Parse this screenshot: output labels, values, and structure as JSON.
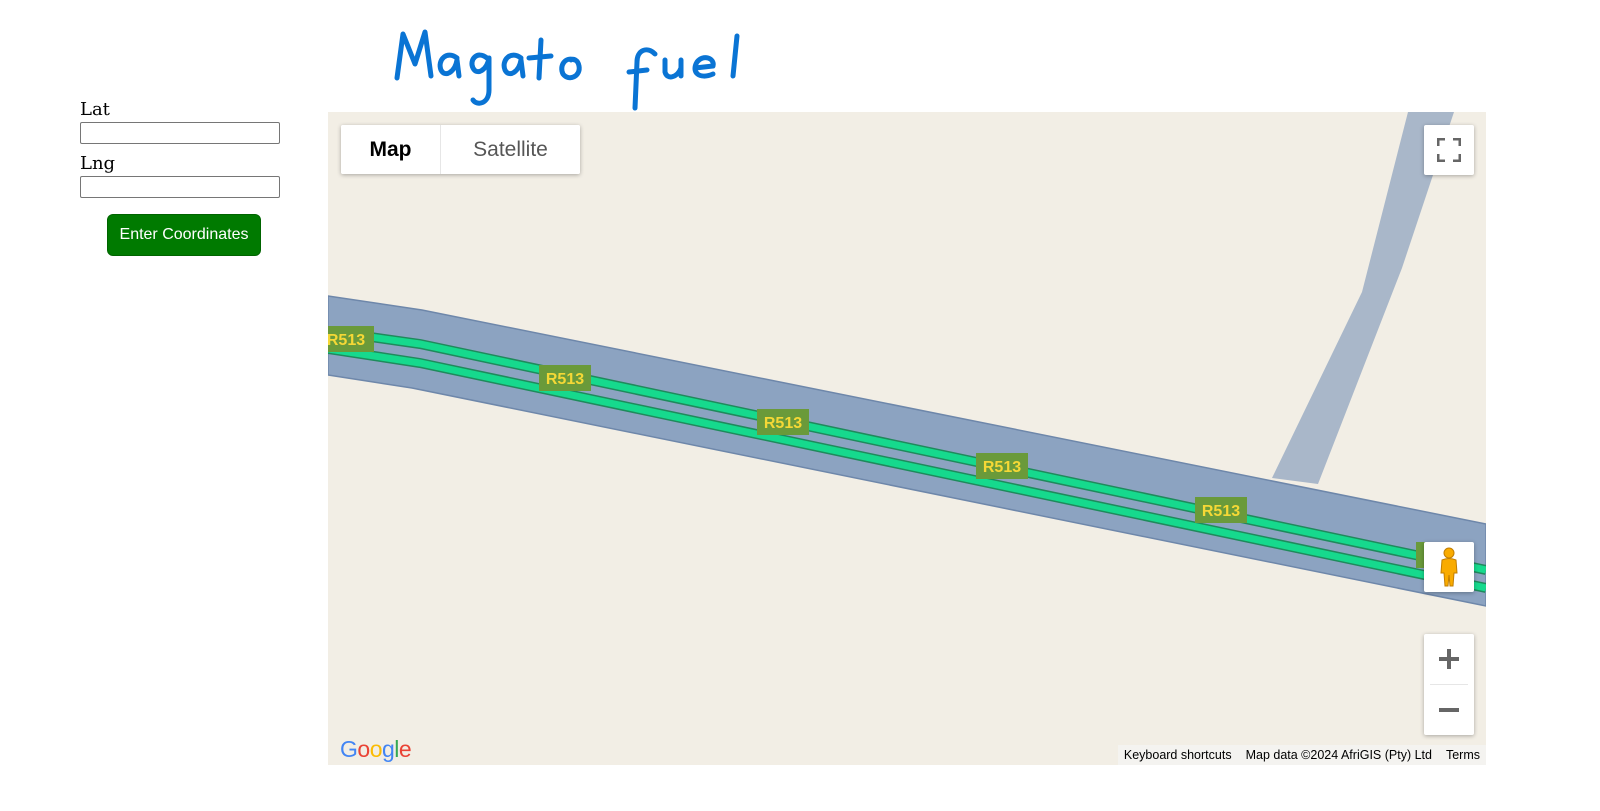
{
  "header": {
    "title": "Magato fuel",
    "title_color": "#0a74d4"
  },
  "form": {
    "lat_label": "Lat",
    "lat_value": "",
    "lng_label": "Lng",
    "lng_value": "",
    "submit_label": "Enter Coordinates",
    "submit_color": "#007a00"
  },
  "map": {
    "map_type_buttons": {
      "map": "Map",
      "satellite": "Satellite",
      "selected": "Map"
    },
    "road_shields": [
      "R513",
      "R513",
      "R513",
      "R513",
      "R513"
    ],
    "shield_color": "#6a9a3a",
    "shield_text_color": "#f5d836",
    "road_casing_color": "#8ca3c1",
    "road_lane_color": "#16d98d",
    "side_road_color": "#a9b7c9",
    "land_color": "#f2eee5",
    "controls": {
      "fullscreen_icon": "fullscreen-icon",
      "pegman_icon": "pegman-icon",
      "zoom_in_icon": "plus-icon",
      "zoom_out_icon": "minus-icon"
    },
    "logo": "Google",
    "attribution": {
      "keyboard": "Keyboard shortcuts",
      "data": "Map data ©2024 AfriGIS (Pty) Ltd",
      "terms": "Terms"
    }
  }
}
